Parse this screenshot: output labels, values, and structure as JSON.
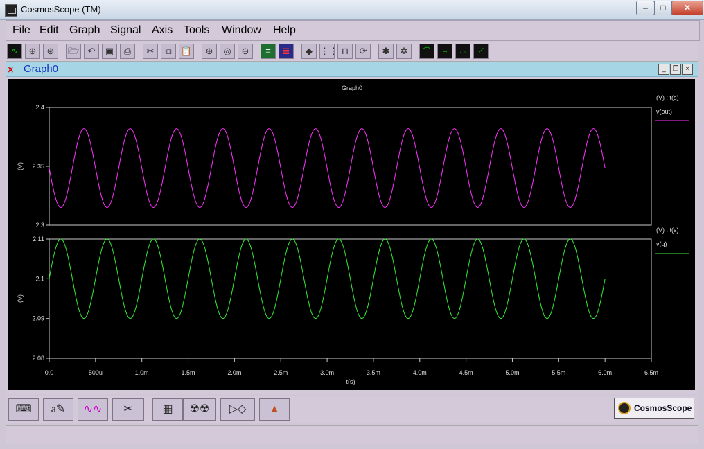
{
  "window": {
    "title": "CosmosScope (TM)"
  },
  "menu": [
    "File",
    "Edit",
    "Graph",
    "Signal",
    "Axis",
    "Tools",
    "Window",
    "Help"
  ],
  "toolbar_icons": [
    "waveform-icon",
    "crosshair-icon",
    "crosshair-alt-icon",
    "open-folder-icon",
    "undo-icon",
    "save-icon",
    "print-icon",
    "cut-icon",
    "copy-icon",
    "paste-icon",
    "zoom-in-icon",
    "zoom-fit-icon",
    "zoom-out-icon",
    "stack-icon",
    "split-icon",
    "erase-icon",
    "grid-icon",
    "digital-icon",
    "refresh-icon",
    "bug-icon",
    "bug-alt-icon",
    "measure-rise-icon",
    "measure-flat-icon",
    "measure-area-icon",
    "measure-slope-icon"
  ],
  "graph": {
    "window_title": "Graph0",
    "title": "Graph0",
    "xlabel": "t(s)",
    "xticks": [
      "0.0",
      "500u",
      "1.0m",
      "1.5m",
      "2.0m",
      "2.5m",
      "3.0m",
      "3.5m",
      "4.0m",
      "4.5m",
      "5.0m",
      "5.5m",
      "6.0m",
      "6.5m"
    ]
  },
  "chart_data": [
    {
      "type": "line",
      "title": "Graph0",
      "xlabel": "t(s)",
      "ylabel": "(V)",
      "legend_header": "(V) : t(s)",
      "series": [
        {
          "name": "v(out)",
          "color": "#ff33ff",
          "offset": 2.3485,
          "amplitude": 0.0335,
          "frequency_hz": 2000,
          "phase_at_t0": "decreasing"
        }
      ],
      "x_range": [
        0,
        0.006
      ],
      "xlim": [
        0,
        0.0065
      ],
      "ylim": [
        2.3,
        2.4
      ],
      "yticks": [
        "2.4",
        "2.35",
        "2.3"
      ],
      "ytick_values": [
        2.4,
        2.35,
        2.3
      ]
    },
    {
      "type": "line",
      "title": "",
      "xlabel": "t(s)",
      "ylabel": "(V)",
      "legend_header": "(V) : t(s)",
      "series": [
        {
          "name": "v(g)",
          "color": "#33ee33",
          "offset": 2.1,
          "amplitude": 0.01,
          "frequency_hz": 2000,
          "phase_at_t0": "increasing"
        }
      ],
      "x_range": [
        0,
        0.006
      ],
      "xlim": [
        0,
        0.0065
      ],
      "ylim": [
        2.08,
        2.11
      ],
      "yticks": [
        "2.11",
        "2.1",
        "2.09",
        "2.08"
      ],
      "ytick_values": [
        2.11,
        2.1,
        2.09,
        2.08
      ]
    }
  ],
  "bottom_tools": [
    "keyboard-icon",
    "annotate-icon",
    "waveform-calc-icon",
    "scissors-icon",
    "calculator-icon",
    "radiation-icon",
    "logic-gates-icon",
    "matlab-icon"
  ],
  "brand": {
    "logo_text": "CosmosScope"
  }
}
